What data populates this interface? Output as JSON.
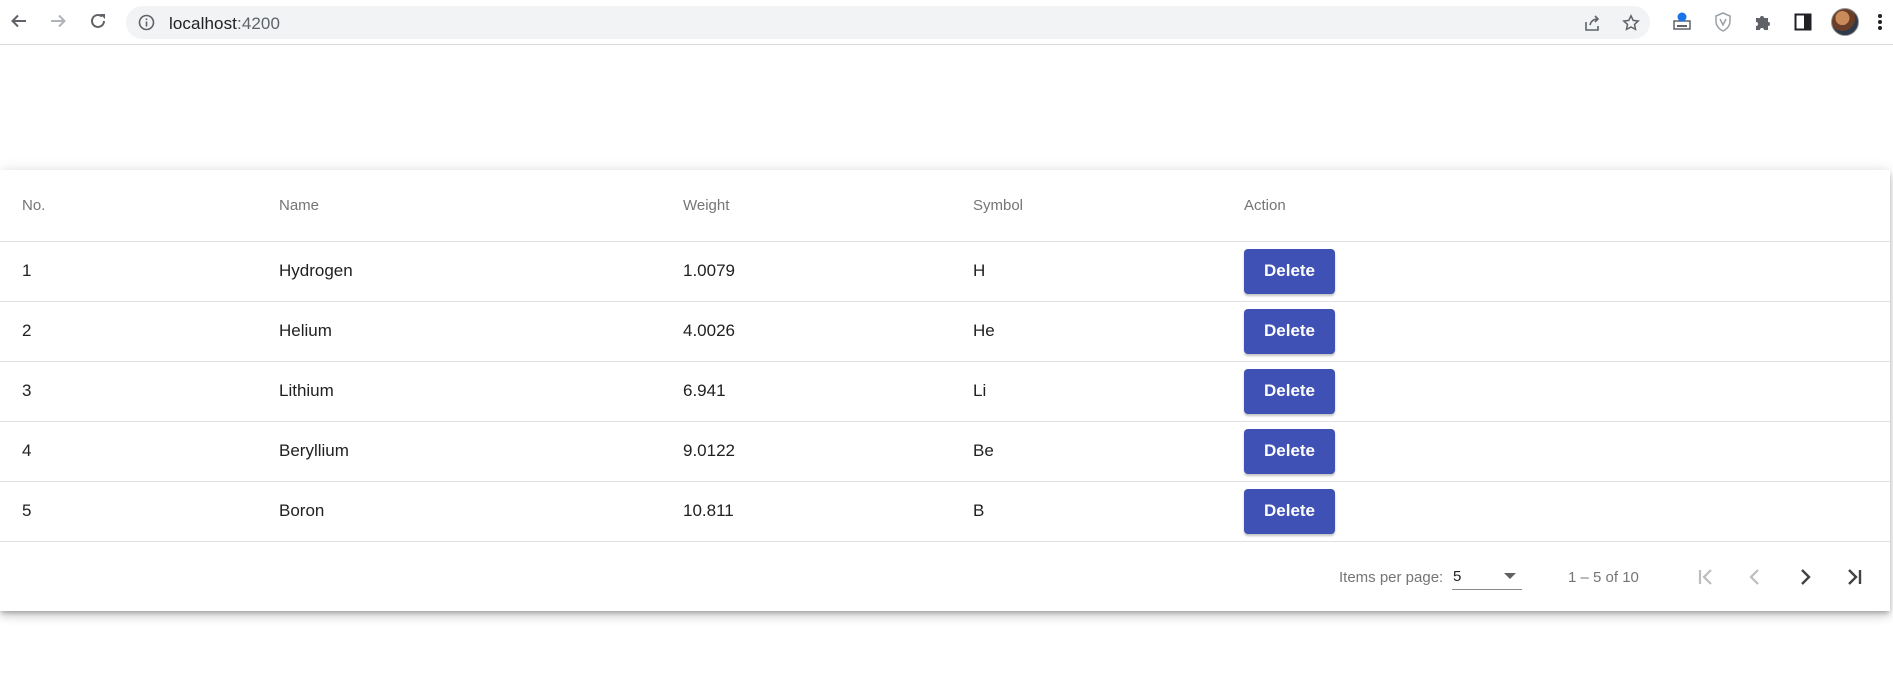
{
  "browser": {
    "url_host": "localhost",
    "url_port": ":4200"
  },
  "table": {
    "headers": [
      "No.",
      "Name",
      "Weight",
      "Symbol",
      "Action"
    ],
    "rows": [
      {
        "no": "1",
        "name": "Hydrogen",
        "weight": "1.0079",
        "symbol": "H",
        "action": "Delete"
      },
      {
        "no": "2",
        "name": "Helium",
        "weight": "4.0026",
        "symbol": "He",
        "action": "Delete"
      },
      {
        "no": "3",
        "name": "Lithium",
        "weight": "6.941",
        "symbol": "Li",
        "action": "Delete"
      },
      {
        "no": "4",
        "name": "Beryllium",
        "weight": "9.0122",
        "symbol": "Be",
        "action": "Delete"
      },
      {
        "no": "5",
        "name": "Boron",
        "weight": "10.811",
        "symbol": "B",
        "action": "Delete"
      }
    ]
  },
  "paginator": {
    "items_per_page_label": "Items per page:",
    "items_per_page_value": "5",
    "range_label": "1 – 5 of 10"
  },
  "colors": {
    "primary": "#3f51b5",
    "header_text": "#757575",
    "cell_text": "#212121"
  }
}
